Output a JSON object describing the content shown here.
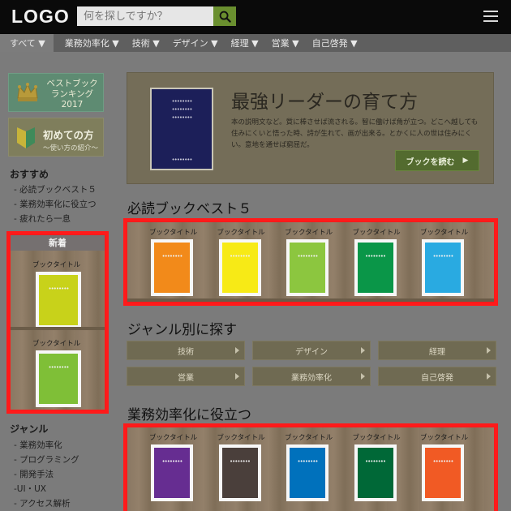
{
  "header": {
    "logo": "LOGO",
    "search_placeholder": "何を探しですか？"
  },
  "nav": {
    "items": [
      "すべて ▼",
      "業務効率化 ▼",
      "技術 ▼",
      "デザイン ▼",
      "経理 ▼",
      "営業 ▼",
      "自己啓発 ▼"
    ]
  },
  "sidebar": {
    "banner_bestbook": {
      "line1": "ベストブック",
      "line2": "ランキング",
      "line3": "2017"
    },
    "banner_first": {
      "title": "初めての方",
      "subtitle": "〜使い方の紹介〜"
    },
    "recommend": {
      "heading": "おすすめ",
      "links": [
        "- 必読ブックベスト５",
        "- 業務効率化に役立つ",
        "- 疲れたら一息"
      ]
    },
    "new_arrivals": {
      "heading": "新着",
      "books": [
        {
          "title": "ブックタイトル",
          "color": "#c8d21a"
        },
        {
          "title": "ブックタイトル",
          "color": "#7fbf37"
        }
      ]
    },
    "genre": {
      "heading": "ジャンル",
      "links": [
        "- 業務効率化",
        "- プログラミング",
        "- 開発手法",
        "-UI・UX",
        "- アクセス解析"
      ]
    }
  },
  "hero": {
    "title": "最強リーダーの育て方",
    "description": "本の説明文など。質に棒させば流される。智に働けば角が立つ。どこへ越しても住みにくいと悟った時、詩が生れて、画が出来る。とかくに人の世は住みにくい。意地を通せば窮屈だ。",
    "button_label": "ブックを読む",
    "button_arrow": "▶",
    "book_color": "#1c1f59"
  },
  "best5": {
    "heading": "必読ブックベスト５",
    "books": [
      {
        "title": "ブックタイトル",
        "color": "#f28a1a"
      },
      {
        "title": "ブックタイトル",
        "color": "#f7ea16"
      },
      {
        "title": "ブックタイトル",
        "color": "#8cc63f"
      },
      {
        "title": "ブックタイトル",
        "color": "#0a9648"
      },
      {
        "title": "ブックタイトル",
        "color": "#29aae1"
      }
    ]
  },
  "genre_search": {
    "heading": "ジャンル別に探す",
    "buttons": [
      "技術",
      "デザイン",
      "経理",
      "営業",
      "業務効率化",
      "自己啓発"
    ]
  },
  "efficiency": {
    "heading": "業務効率化に役立つ",
    "books": [
      {
        "title": "ブックタイトル",
        "color": "#662d91"
      },
      {
        "title": "ブックタイトル",
        "color": "#4a3f3b"
      },
      {
        "title": "ブックタイトル",
        "color": "#0071bc"
      },
      {
        "title": "ブックタイトル",
        "color": "#006837"
      },
      {
        "title": "ブックタイトル",
        "color": "#f15a24"
      }
    ]
  },
  "colors": {
    "highlight": "#ff1a1a",
    "header_bg": "#0a0a0a",
    "search_button": "#6a8f2f"
  },
  "book_dots": "••••••••"
}
